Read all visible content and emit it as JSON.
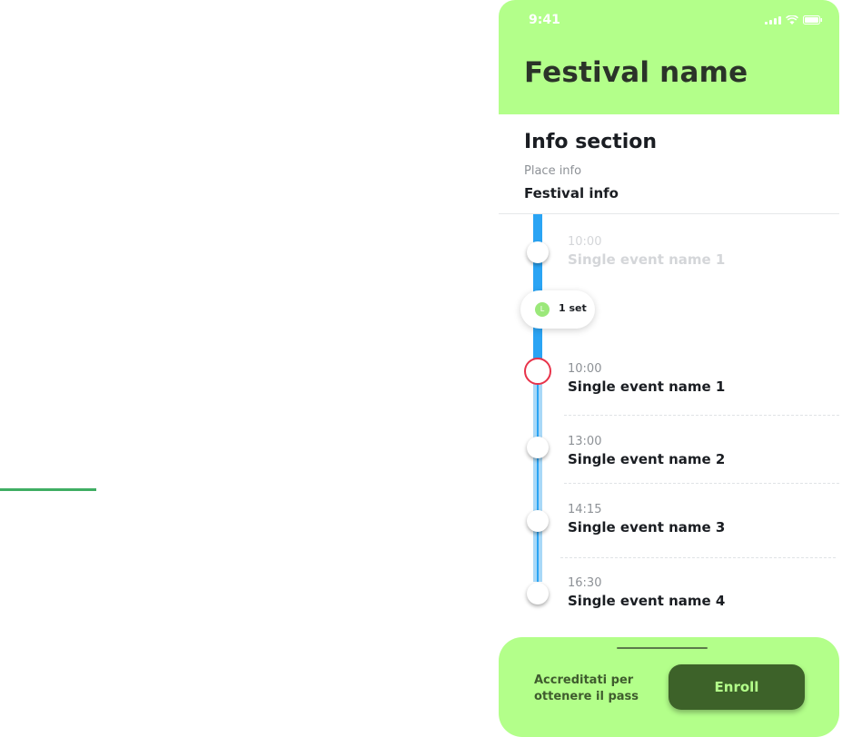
{
  "status_bar": {
    "time": "9:41"
  },
  "header": {
    "title": "Festival name"
  },
  "info": {
    "title": "Info section",
    "place_info": "Place info",
    "festival_info": "Festival info"
  },
  "timeline": {
    "set_pill": {
      "icon_letter": "L",
      "label": "1 set"
    },
    "events": [
      {
        "time": "10:00",
        "name": "Single event name 1"
      },
      {
        "time": "10:00",
        "name": "Single event name 1"
      },
      {
        "time": "13:00",
        "name": "Single event name 2"
      },
      {
        "time": "14:15",
        "name": "Single event name 3"
      },
      {
        "time": "16:30",
        "name": "Single event name 4"
      }
    ]
  },
  "footer": {
    "text": "Accreditati per ottenere il pass",
    "enroll_label": "Enroll"
  },
  "colors": {
    "accent_green": "#b3ff8a",
    "dark_green": "#3d6229",
    "timeline_blue": "#2aa4f4",
    "current_ring": "#e8334a"
  }
}
